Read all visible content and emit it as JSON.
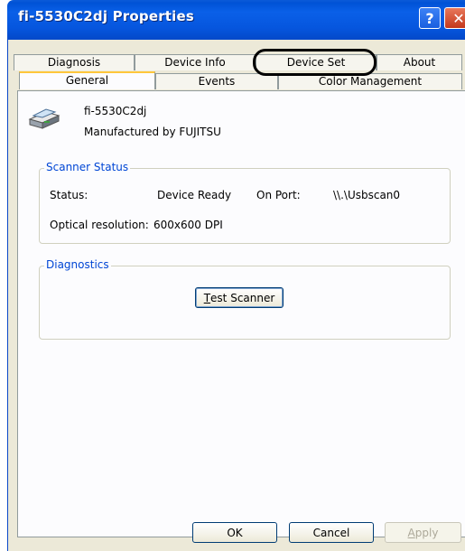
{
  "window": {
    "title": "fi-5530C2dj Properties"
  },
  "title_buttons": {
    "help": "?",
    "close": "✕"
  },
  "tabs_top": [
    "Diagnosis",
    "Device Info",
    "Device Set",
    "About"
  ],
  "tabs_bottom": [
    "General",
    "Events",
    "Color Management"
  ],
  "active_tab": "General",
  "device": {
    "name": "fi-5530C2dj",
    "manufacturer": "Manufactured by  FUJITSU"
  },
  "scanner_status": {
    "title": "Scanner Status",
    "status_label": "Status:",
    "status_value": "Device Ready",
    "port_label": "On Port:",
    "port_value": "\\\\.\\Usbscan0",
    "resolution_label": "Optical resolution:",
    "resolution_value": "600x600 DPI"
  },
  "diagnostics": {
    "title": "Diagnostics",
    "test_button_prefix": "T",
    "test_button_rest": "est Scanner"
  },
  "footer": {
    "ok": "OK",
    "cancel": "Cancel",
    "apply_prefix": "A",
    "apply_rest": "pply"
  },
  "colors": {
    "titlebar": "#0a5ad8",
    "dialog": "#ece9d8",
    "group_title": "#0046d5",
    "active_tab_accent": "#ffc73c"
  }
}
